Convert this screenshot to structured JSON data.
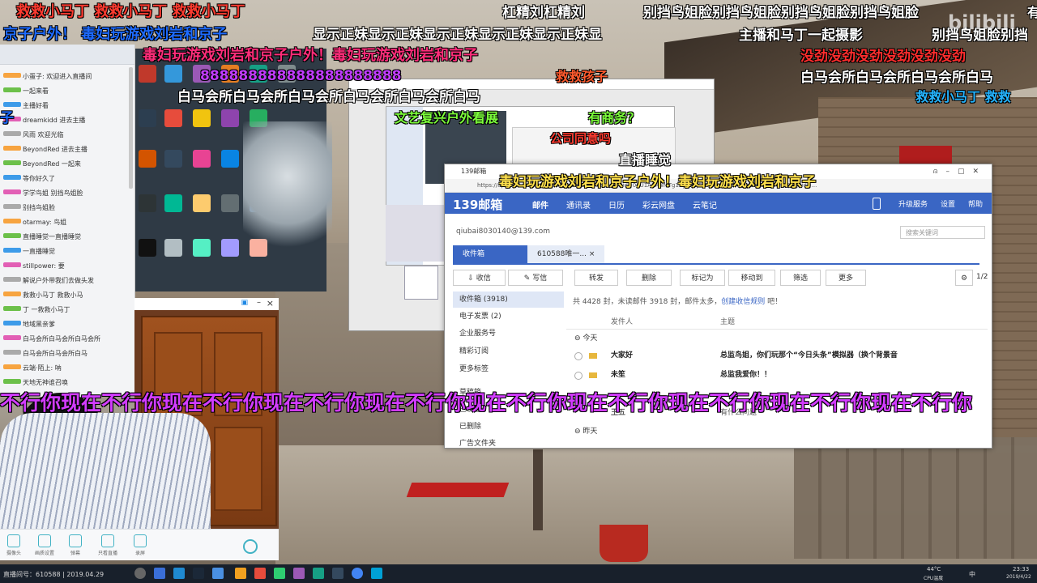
{
  "danmaku": [
    {
      "text": "救救小马丁 救救小马丁 救救小马丁",
      "color": "#ff3b30",
      "size": 18
    },
    {
      "text": "京子户外！ 毒妇玩游戏刘岩和京子",
      "color": "#1e6bff",
      "size": 18
    },
    {
      "text": "毒妇玩游戏刘岩和京子户外！毒妇玩游戏刘岩和京子",
      "color": "#ff2d7a",
      "size": 18
    },
    {
      "text": "888888888888888888888",
      "color": "#c13cff",
      "size": 17
    },
    {
      "text": "白马会所白马会所白马会所白马会所白马会所白马",
      "color": "#ffffff",
      "size": 17
    },
    {
      "text": "显示正妹显示正妹显示正妹显示正妹显示正妹显",
      "color": "#ffffff",
      "size": 17
    },
    {
      "text": "杠精刘杠精刘",
      "color": "#ffffff",
      "size": 17
    },
    {
      "text": "别挡鸟姐脸别挡鸟姐脸别挡鸟姐脸别挡鸟姐脸",
      "color": "#ffffff",
      "size": 17
    },
    {
      "text": "主播和马丁一起摄影",
      "color": "#ffffff",
      "size": 17
    },
    {
      "text": "别挡鸟姐脸别挡",
      "color": "#ffffff",
      "size": 17
    },
    {
      "text": "没劲没劲没劲没劲没劲没劲",
      "color": "#ff2d2d",
      "size": 17
    },
    {
      "text": "白马会所白马会所白马会所白马",
      "color": "#ffffff",
      "size": 17
    },
    {
      "text": "救救小马丁 救救",
      "color": "#24b4ff",
      "size": 16
    },
    {
      "text": "救救孩子",
      "color": "#ff5a2d",
      "size": 16
    },
    {
      "text": "文艺复兴户外看展",
      "color": "#7cff3b",
      "size": 16
    },
    {
      "text": "有商务？",
      "color": "#7cff3b",
      "size": 16
    },
    {
      "text": "公司同意吗",
      "color": "#ff3b30",
      "size": 15
    },
    {
      "text": "直播睡觉",
      "color": "#ffffff",
      "size": 16
    },
    {
      "text": "毒妇玩游戏刘岩和京子户外！毒妇玩游戏刘岩和京子",
      "color": "#ffe14d",
      "size": 17
    },
    {
      "text": "不行你现在不行你现在不行你现在不行你现在不行你现在不行你现在不行你现在不行你现在不行你现在不行你",
      "color": "#d23cff",
      "size": 25
    },
    {
      "text": "子",
      "color": "#1e6bff",
      "size": 17
    },
    {
      "text": "有",
      "color": "#ffffff",
      "size": 16
    }
  ],
  "watermark": "bilibili",
  "mail": {
    "window_title": "139邮箱",
    "address": "https://appmail.mail.10086.cn/m2015/index.html?sid=00U1A1AwMTg1NjE4MjEzMzA4M...&rnd=258&k=0771&cguid=...",
    "logo": "139邮箱",
    "nav": [
      "邮件",
      "通讯录",
      "日历",
      "彩云网盘",
      "云笔记"
    ],
    "nav_right": [
      "升级服务",
      "设置",
      "帮助"
    ],
    "account": "qiubai8030140@139.com",
    "search_placeholder": "搜索关键词",
    "tabs": {
      "inbox": "收件箱",
      "open_mail": "610588唯一..."
    },
    "recv_label": "收信",
    "write_label": "写信",
    "folders": [
      {
        "label": "收件箱 (3918)"
      },
      {
        "label": "电子发票 (2)"
      },
      {
        "label": "企业服务号"
      },
      {
        "label": "精彩订阅"
      },
      {
        "label": "更多标签"
      },
      {
        "label": "草稿箱"
      },
      {
        "label": "已发送"
      },
      {
        "label": "已删除"
      },
      {
        "label": "广告文件夹"
      }
    ],
    "toolbar": [
      "转发",
      "删除",
      "标记为",
      "移动到",
      "筛选",
      "更多"
    ],
    "page": "1/2",
    "summary_a": "共 4428 封，未读邮件 3918 封，邮件太多，",
    "summary_link": "创建收信规则",
    "summary_b": " 吧！",
    "col_from": "发件人",
    "col_subject": "主题",
    "group_today": "今天",
    "group_yesterday": "昨天",
    "rows": [
      {
        "from": "大家好",
        "subject": "总监鸟姐，你们玩那个“今日头条”模拟器（换个背景音"
      },
      {
        "from": "未笙",
        "subject": "总监我爱你！！"
      },
      {
        "from": "王五",
        "subject": "有什么问题"
      }
    ]
  },
  "chat": {
    "lines": [
      "小蛋子: 欢迎进入直播间",
      "一起来看",
      "主播好看",
      "dreamkidd 进去主播",
      "风雨 欢迎光临",
      "BeyondRed 进去主播",
      "BeyondRed 一起来",
      "等你好久了",
      "学学鸟姐 别挡鸟姐脸",
      "别挡鸟姐脸",
      "otarmay: 鸟姐",
      "直播睡觉一直播睡觉",
      "一直播睡觉",
      "stillpower: 要",
      "解说户外带我们去做头发",
      "救救小马丁 救救小马",
      "丁 一救救小马丁",
      "地域黑亲爹",
      "白马会所白马会所白马会所",
      "白马会所白马会所白马",
      "云端·陌上: 呐",
      "天地无神谁召唤"
    ]
  },
  "cam": {
    "title": "",
    "close": "×"
  },
  "camtoolbar": [
    "摄像头",
    "画质设置",
    "弹幕",
    "只看直播",
    "录屏"
  ],
  "taskbar": {
    "room": "直播间号：610588 | 2019.04.29",
    "time": "23:33",
    "date": "2019/4/22",
    "temp": "44°C",
    "cpu": "CPU温度",
    "ime": "中"
  }
}
